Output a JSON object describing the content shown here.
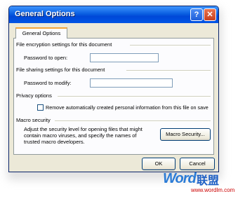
{
  "window": {
    "title": "General Options"
  },
  "tabs": [
    {
      "label": "General Options"
    }
  ],
  "encryption": {
    "heading": "File encryption settings for this document",
    "password_label": "Password to open:",
    "password_value": ""
  },
  "sharing": {
    "heading": "File sharing settings for this document",
    "password_label": "Password to modify:",
    "password_value": ""
  },
  "privacy": {
    "heading": "Privacy options",
    "checkbox_label": "Remove automatically created personal information from this file on save",
    "checked": false
  },
  "macro": {
    "heading": "Macro security",
    "description_lines": [
      "Adjust the security level for opening files that might",
      "contain macro viruses, and specify the names of",
      "trusted macro developers."
    ],
    "button_label": "Macro Security..."
  },
  "footer": {
    "ok_label": "OK",
    "cancel_label": "Cancel"
  },
  "watermark": {
    "brand": "Word",
    "chinese": "联盟",
    "url": "www.wordlm.com"
  }
}
